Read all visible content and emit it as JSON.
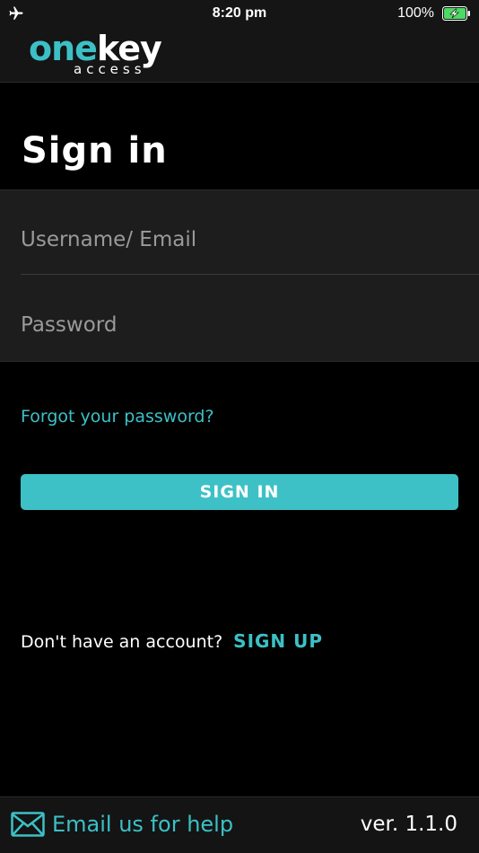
{
  "status_bar": {
    "time": "8:20 pm",
    "battery_percent": "100%",
    "battery_color": "#4cd964",
    "icons": [
      "airplane-icon",
      "battery-charging-icon"
    ]
  },
  "header": {
    "logo_word_part1": "one",
    "logo_word_part2": "key",
    "logo_sub": "access",
    "brand_color": "#3cc0c6"
  },
  "page": {
    "title": "Sign in"
  },
  "form": {
    "username_placeholder": "Username/ Email",
    "username_value": "",
    "password_placeholder": "Password",
    "password_value": "",
    "forgot_label": "Forgot your password?",
    "submit_label": "SIGN IN"
  },
  "signup": {
    "prompt": "Don't have an account?",
    "link_label": "SIGN UP"
  },
  "footer": {
    "help_label": "Email us for help",
    "version": "ver. 1.1.0",
    "help_icon": "mail-icon"
  }
}
